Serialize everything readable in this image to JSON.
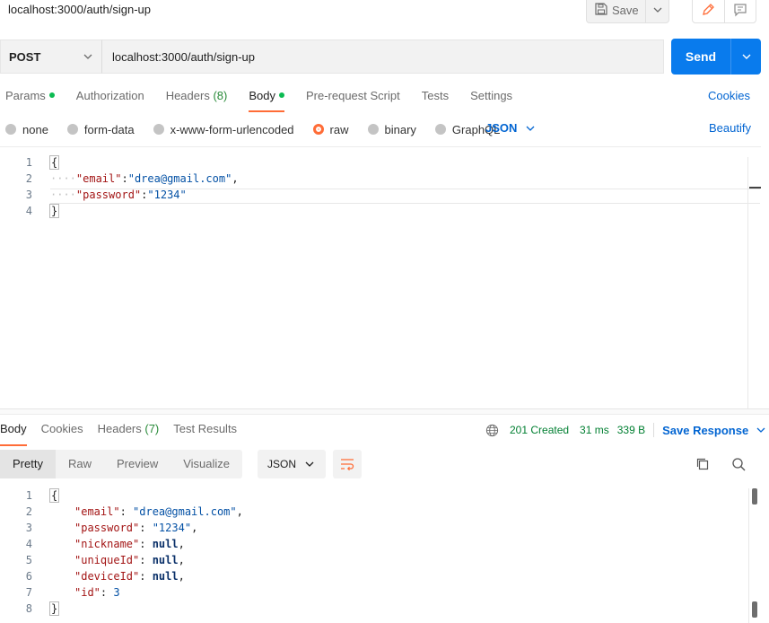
{
  "request": {
    "title": "localhost:3000/auth/sign-up",
    "save_label": "Save",
    "method": "POST",
    "url": "localhost:3000/auth/sign-up",
    "send_label": "Send",
    "tabs": [
      {
        "label": "Params",
        "count": "",
        "dot": true,
        "active": false
      },
      {
        "label": "Authorization",
        "count": "",
        "dot": false,
        "active": false
      },
      {
        "label": "Headers",
        "count": "(8)",
        "dot": false,
        "active": false
      },
      {
        "label": "Body",
        "count": "",
        "dot": true,
        "active": true
      },
      {
        "label": "Pre-request Script",
        "count": "",
        "dot": false,
        "active": false
      },
      {
        "label": "Tests",
        "count": "",
        "dot": false,
        "active": false
      },
      {
        "label": "Settings",
        "count": "",
        "dot": false,
        "active": false
      }
    ],
    "cookies_label": "Cookies",
    "body_types": [
      "none",
      "form-data",
      "x-www-form-urlencoded",
      "raw",
      "binary",
      "GraphQL"
    ],
    "body_type_selected": "raw",
    "language": "JSON",
    "beautify_label": "Beautify",
    "body_lines": [
      "{",
      "\"email\":\"drea@gmail.com\",",
      "\"password\":\"1234\"",
      "}"
    ],
    "line_numbers": [
      "1",
      "2",
      "3",
      "4"
    ]
  },
  "response": {
    "tabs": [
      {
        "label": "Body",
        "count": "",
        "active": true
      },
      {
        "label": "Cookies",
        "count": "",
        "active": false
      },
      {
        "label": "Headers",
        "count": "(7)",
        "active": false
      },
      {
        "label": "Test Results",
        "count": "",
        "active": false
      }
    ],
    "status": "201 Created",
    "time": "31 ms",
    "size": "339 B",
    "save_response_label": "Save Response",
    "views": [
      "Pretty",
      "Raw",
      "Preview",
      "Visualize"
    ],
    "view_selected": "Pretty",
    "format": "JSON",
    "line_numbers": [
      "1",
      "2",
      "3",
      "4",
      "5",
      "6",
      "7",
      "8"
    ],
    "fields": [
      {
        "key": "\"email\"",
        "value": "\"drea@gmail.com\"",
        "type": "string",
        "comma": ","
      },
      {
        "key": "\"password\"",
        "value": "\"1234\"",
        "type": "string",
        "comma": ","
      },
      {
        "key": "\"nickname\"",
        "value": "null",
        "type": "keyword",
        "comma": ","
      },
      {
        "key": "\"uniqueId\"",
        "value": "null",
        "type": "keyword",
        "comma": ","
      },
      {
        "key": "\"deviceId\"",
        "value": "null",
        "type": "keyword",
        "comma": ","
      },
      {
        "key": "\"id\"",
        "value": "3",
        "type": "number",
        "comma": ""
      }
    ]
  },
  "colors": {
    "accent": "#ff6c37",
    "send": "#097bed",
    "link": "#0265d2",
    "status_ok": "#007f31"
  },
  "icons": [
    "save-icon",
    "chevron-down-icon",
    "pencil-icon",
    "comment-icon",
    "globe-icon",
    "wrap-lines-icon",
    "copy-icon",
    "search-icon"
  ]
}
